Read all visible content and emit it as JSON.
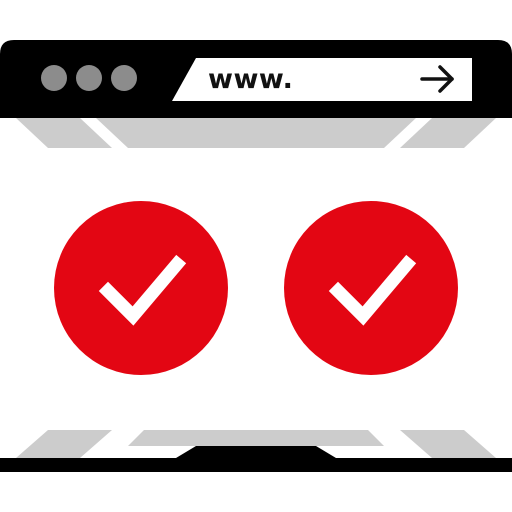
{
  "address_bar": {
    "text": "www.",
    "go_icon": "arrow-right-icon"
  },
  "window_controls": {
    "icon": "window-control-dot-icon",
    "count": 3,
    "color": "#8c8c8c"
  },
  "check_badges": [
    {
      "icon": "checkmark-icon",
      "color": "#e30613"
    },
    {
      "icon": "checkmark-icon",
      "color": "#e30613"
    }
  ],
  "colors": {
    "frame": "#000000",
    "accent": "#e30613",
    "stripe": "#cccccc",
    "page": "#ffffff"
  }
}
